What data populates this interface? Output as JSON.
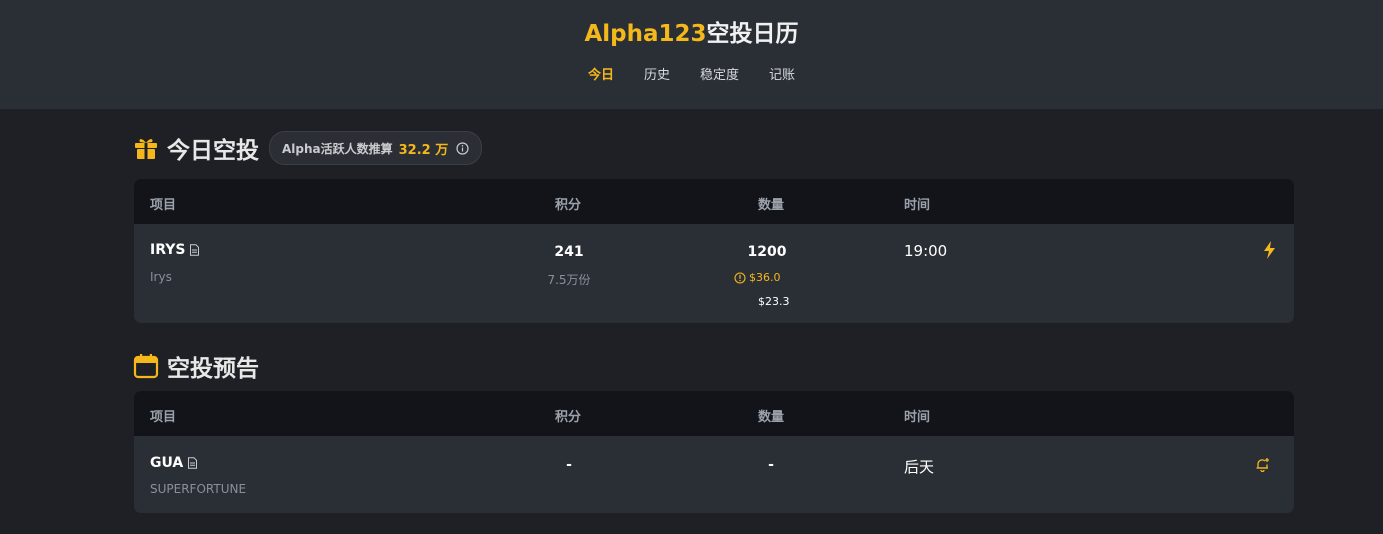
{
  "header": {
    "title_brand": "Alpha123",
    "title_rest": "空投日历",
    "nav": [
      "今日",
      "历史",
      "稳定度",
      "记账"
    ],
    "active_nav": "今日"
  },
  "today": {
    "heading": "今日空投",
    "pill_label": "Alpha活跃人数推算",
    "pill_value": "32.2 万",
    "columns": [
      "项目",
      "积分",
      "数量",
      "时间"
    ],
    "rows": [
      {
        "symbol": "IRYS",
        "name": "Irys",
        "points": "241",
        "points_sub": "7.5万份",
        "amount": "1200",
        "value_warn": "$36.0",
        "value": "$23.3",
        "time": "19:00"
      }
    ]
  },
  "upcoming": {
    "heading": "空投预告",
    "columns": [
      "项目",
      "积分",
      "数量",
      "时间"
    ],
    "rows": [
      {
        "symbol": "GUA",
        "name": "SUPERFORTUNE",
        "points": "-",
        "amount": "-",
        "time": "后天"
      }
    ]
  },
  "colors": {
    "accent": "#f5b81b",
    "bg": "#1f2025",
    "header_bg": "#2a2f36",
    "table_head": "#121419"
  },
  "icons": [
    "gift-icon",
    "info-icon",
    "document-icon",
    "lightning-icon",
    "calendar-icon",
    "bell-add-icon",
    "warning-circle-icon"
  ]
}
